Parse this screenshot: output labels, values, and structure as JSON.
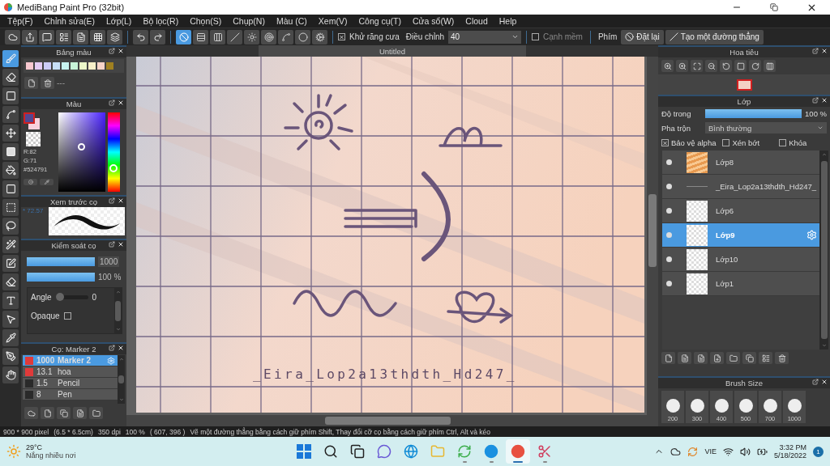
{
  "window": {
    "title": "MediBang Paint Pro (32bit)"
  },
  "menu": [
    "Tệp(F)",
    "Chỉnh sửa(E)",
    "Lớp(L)",
    "Bộ lọc(R)",
    "Chọn(S)",
    "Chụp(N)",
    "Màu (C)",
    "Xem(V)",
    "Công cụ(T)",
    "Cửa sổ(W)",
    "Cloud",
    "Help"
  ],
  "toolbar": {
    "ruler_modes": [
      {
        "selected": true
      },
      {
        "selected": false
      },
      {
        "selected": false
      },
      {
        "selected": false
      },
      {
        "selected": false
      },
      {
        "selected": false
      },
      {
        "selected": false
      },
      {
        "selected": false
      },
      {
        "selected": false
      }
    ],
    "antialias": {
      "label": "Khử răng cưa",
      "checked": true
    },
    "adjust": {
      "label": "Điều chỉnh",
      "value": "40"
    },
    "soft_edge": {
      "label": "Cạnh mềm",
      "checked": false
    },
    "key_label": "Phím",
    "buttons": [
      "Đặt lại",
      "Tạo một đường thẳng"
    ]
  },
  "tools": [
    {
      "selected": true
    },
    {
      "selected": false
    },
    {
      "selected": false
    },
    {
      "selected": false
    },
    {
      "selected": false
    },
    {
      "selected": false
    },
    {
      "selected": false
    },
    {
      "selected": false
    },
    {
      "selected": false
    },
    {
      "selected": false
    },
    {
      "selected": false
    },
    {
      "selected": false
    },
    {
      "selected": false
    },
    {
      "selected": false
    },
    {
      "selected": false
    },
    {
      "selected": false
    },
    {
      "selected": false
    },
    {
      "selected": false
    }
  ],
  "palette_panel": {
    "title": "Bảng màu",
    "swatches": [
      {
        "color": "#f8c8d0"
      },
      {
        "color": "#e4ccf4"
      },
      {
        "color": "#ccccf8"
      },
      {
        "color": "#c8e0f8"
      },
      {
        "color": "#c8f4f0"
      },
      {
        "color": "#c8f4d8"
      },
      {
        "color": "#ecf8c8"
      },
      {
        "color": "#f8f0c8"
      },
      {
        "color": "#f8d4c8"
      },
      {
        "color": "#a08020"
      }
    ],
    "name": "---"
  },
  "color_panel": {
    "title": "Màu",
    "foreground": {
      "color": "#524791"
    },
    "background": {
      "color": "#f8d0dc"
    },
    "hue": {
      "level": 0.27
    },
    "readout": [
      "R:82",
      "G:71"
    ],
    "hex": "#524791"
  },
  "brush_preview": {
    "title": "Xem trước cọ",
    "size": "* 72.57"
  },
  "brush_control": {
    "title": "Kiểm soát cọ",
    "size": {
      "level": 1,
      "value": "1000"
    },
    "opacity": {
      "level": 1,
      "value": "100 %"
    },
    "angle": {
      "label": "Angle",
      "level": 0,
      "value": "0"
    },
    "opaque": {
      "label": "Opaque",
      "checked": false
    }
  },
  "brush_list": {
    "title": "Cọ: Marker 2",
    "items": [
      {
        "size": "1000",
        "name": "Marker 2",
        "color": "#e03a3a",
        "selected": true
      },
      {
        "size": "13.1",
        "name": "hoa",
        "color": "#e03a3a",
        "selected": false
      },
      {
        "size": "1.5",
        "name": "Pencil",
        "color": "#2a2a2a",
        "selected": false
      },
      {
        "size": "8",
        "name": "Pen",
        "color": "#2a2a2a",
        "selected": false
      }
    ]
  },
  "canvas": {
    "tab": "Untitled",
    "text": "_Eira_Lop2a13thdth_Hd247_"
  },
  "navigator": {
    "title": "Hoa tiêu"
  },
  "layers": {
    "title": "Lớp",
    "opacity": {
      "label": "Độ trong",
      "level": 1,
      "value": "100 %"
    },
    "blend": {
      "label": "Pha trộn",
      "value": "Bình thường"
    },
    "options": [
      {
        "label": "Bảo vệ alpha",
        "checked": true
      },
      {
        "label": "Xén bớt",
        "checked": false
      },
      {
        "label": "Khóa",
        "checked": false
      }
    ],
    "items": [
      {
        "name": "Lớp8",
        "kind": "stripes",
        "selected": false
      },
      {
        "name": "_Eira_Lop2a13thdth_Hd247_",
        "kind": "text",
        "selected": false
      },
      {
        "name": "Lớp6",
        "kind": "raster",
        "selected": false
      },
      {
        "name": "Lớp9",
        "kind": "raster",
        "selected": true
      },
      {
        "name": "Lớp10",
        "kind": "raster",
        "selected": false
      },
      {
        "name": "Lớp1",
        "kind": "raster",
        "selected": false
      }
    ]
  },
  "brush_size": {
    "title": "Brush Size",
    "sizes": [
      "200",
      "300",
      "400",
      "500",
      "700",
      "1000"
    ]
  },
  "status_bar": [
    "900 * 900 pixel",
    "(6.5 * 6.5cm)",
    "350 dpi",
    "100 %",
    "( 607, 396 )",
    "Vẽ một đường thẳng bằng cách giữ phím Shift, Thay đổi cỡ cọ bằng cách giữ phím Ctrl, Alt và kéo"
  ],
  "taskbar": {
    "weather": {
      "temp": "29°C",
      "text": "Nắng nhiều nơi"
    },
    "apps": [
      {
        "selected": false,
        "running": false
      },
      {
        "selected": false,
        "running": false
      },
      {
        "selected": false,
        "running": false
      },
      {
        "selected": false,
        "running": false
      },
      {
        "selected": false,
        "running": false
      },
      {
        "selected": false,
        "running": false
      },
      {
        "selected": false,
        "running": true
      },
      {
        "selected": false,
        "running": true
      },
      {
        "selected": true,
        "running": true
      },
      {
        "selected": false,
        "running": true
      }
    ],
    "language": "VIE",
    "time": "3:32 PM",
    "date": "5/18/2022",
    "notifications": "1"
  }
}
